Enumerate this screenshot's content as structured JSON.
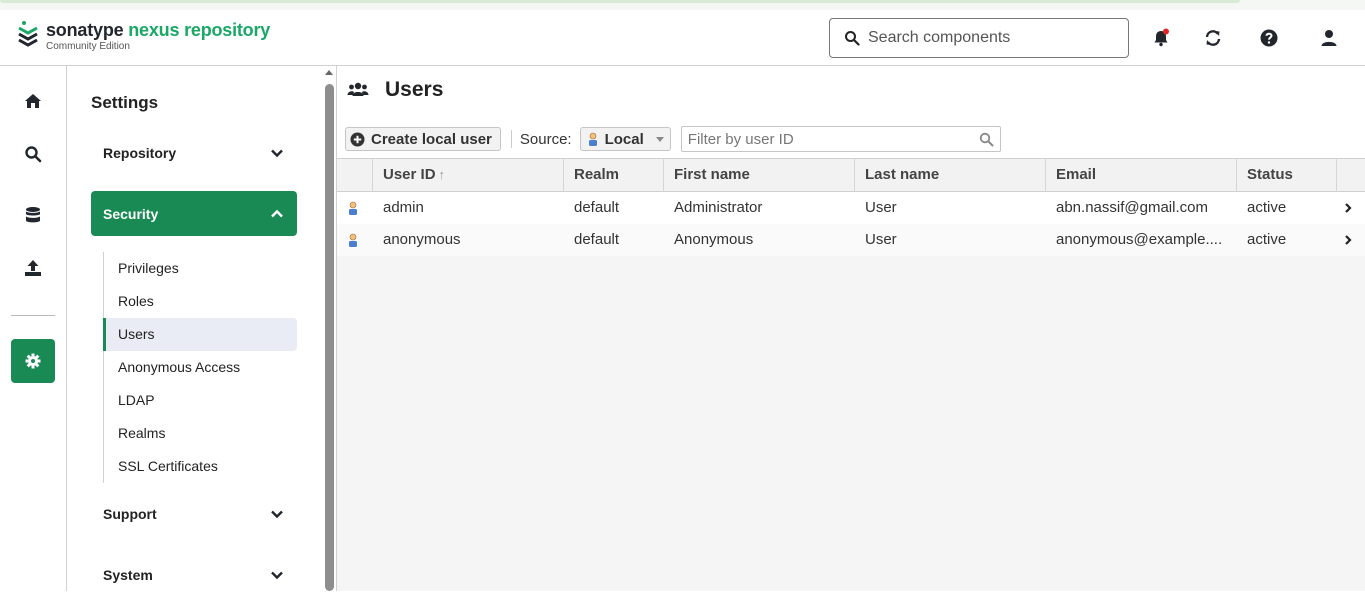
{
  "header": {
    "brand_first": "sonatype",
    "brand_second": "nexus repository",
    "edition": "Community Edition",
    "search_placeholder": "Search components"
  },
  "settings": {
    "title": "Settings",
    "groups": {
      "repository": "Repository",
      "security": "Security",
      "support": "Support",
      "system": "System"
    },
    "security_items": [
      "Privileges",
      "Roles",
      "Users",
      "Anonymous Access",
      "LDAP",
      "Realms",
      "SSL Certificates"
    ]
  },
  "page": {
    "title": "Users",
    "create_button": "Create local user",
    "source_label": "Source:",
    "source_value": "Local",
    "filter_placeholder": "Filter by user ID"
  },
  "table": {
    "columns": [
      "User ID",
      "Realm",
      "First name",
      "Last name",
      "Email",
      "Status"
    ],
    "rows": [
      {
        "user_id": "admin",
        "realm": "default",
        "first_name": "Administrator",
        "last_name": "User",
        "email": "abn.nassif@gmail.com",
        "status": "active"
      },
      {
        "user_id": "anonymous",
        "realm": "default",
        "first_name": "Anonymous",
        "last_name": "User",
        "email": "anonymous@example....",
        "status": "active"
      }
    ]
  },
  "colors": {
    "accent": "#1a8a55",
    "brand_green": "#1aa866"
  },
  "icons": [
    "sonatype-logo-icon",
    "search-icon",
    "bell-icon",
    "refresh-icon",
    "help-icon",
    "user-icon",
    "home-icon",
    "database-icon",
    "upload-icon",
    "gear-icon",
    "users-icon",
    "plus-circle-icon",
    "chevron-down-icon",
    "chevron-up-icon",
    "chevron-right-icon",
    "user-row-icon",
    "sort-up-icon"
  ]
}
